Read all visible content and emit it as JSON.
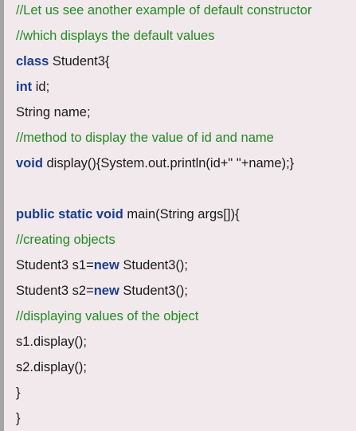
{
  "code": {
    "comment_1": "//Let us see another example of default constructor",
    "comment_2": "//which displays the default values",
    "line_3": {
      "kw": "class",
      "text": " Student3{"
    },
    "line_4": {
      "kw": "int",
      "text": " id;"
    },
    "line_5": "String name;",
    "comment_6": "//method to display the value of id and name",
    "line_7": {
      "kw": "void",
      "text": " display(){System.out.println(id+\" \"+name);}"
    },
    "line_9": {
      "kw": "public static void",
      "text": " main(String args[]){"
    },
    "comment_10": "//creating objects",
    "line_11": {
      "pre": "Student3 s1=",
      "kw": "new",
      "post": " Student3();"
    },
    "line_12": {
      "pre": "Student3 s2=",
      "kw": "new",
      "post": " Student3();"
    },
    "comment_13": "//displaying values of the object",
    "line_14": "s1.display();",
    "line_15": "s2.display();",
    "line_16": "}",
    "line_17": "}"
  },
  "colors": {
    "background": "#f1e9ec",
    "border": "#a5a5a5",
    "comment": "#248a24",
    "keyword": "#1a3d8f",
    "text": "#1a1a1a"
  }
}
